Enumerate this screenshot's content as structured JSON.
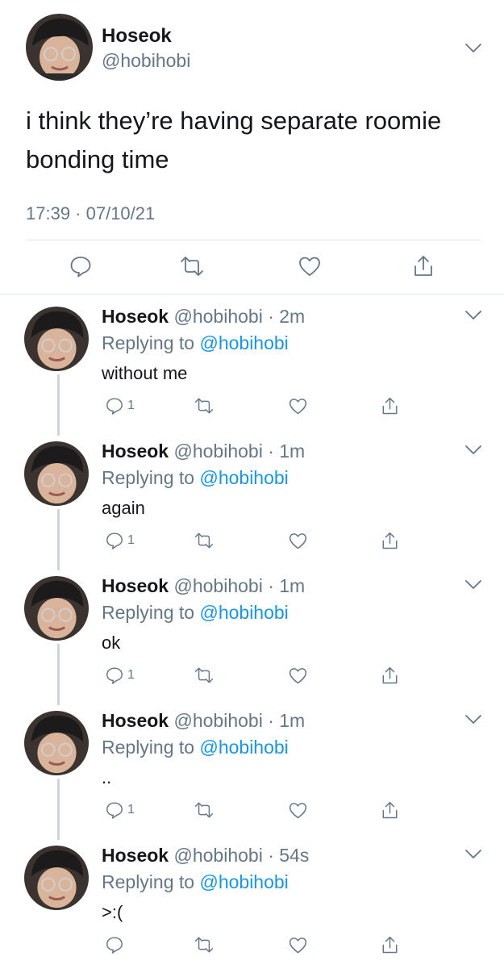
{
  "main_tweet": {
    "name": "Hoseok",
    "handle": "@hobihobi",
    "text": "i think they’re having separate roomie bonding time",
    "timestamp": "17:39 · 07/10/21",
    "actions": [
      "reply-icon",
      "retweet-icon",
      "like-icon",
      "share-icon"
    ],
    "avatar": "profile-photo"
  },
  "replies": [
    {
      "name": "Hoseok",
      "handle": "@hobihobi",
      "time": "· 2m",
      "replying_prefix": "Replying to",
      "replying_to": "@hobihobi",
      "text": "without me",
      "reply_count": "1"
    },
    {
      "name": "Hoseok",
      "handle": "@hobihobi",
      "time": "· 1m",
      "replying_prefix": "Replying to",
      "replying_to": "@hobihobi",
      "text": "again",
      "reply_count": "1"
    },
    {
      "name": "Hoseok",
      "handle": "@hobihobi",
      "time": "· 1m",
      "replying_prefix": "Replying to",
      "replying_to": "@hobihobi",
      "text": "ok",
      "reply_count": "1"
    },
    {
      "name": "Hoseok",
      "handle": "@hobihobi",
      "time": "· 1m",
      "replying_prefix": "Replying to",
      "replying_to": "@hobihobi",
      "text": "..",
      "reply_count": "1"
    },
    {
      "name": "Hoseok",
      "handle": "@hobihobi",
      "time": "· 54s",
      "replying_prefix": "Replying to",
      "replying_to": "@hobihobi",
      "text": ">:(",
      "reply_count": ""
    }
  ],
  "colors": {
    "text": "#14171a",
    "secondary": "#657786",
    "mention": "#1b95e0",
    "divider": "#e1e8ed",
    "thread_line": "#ccd6dd"
  }
}
